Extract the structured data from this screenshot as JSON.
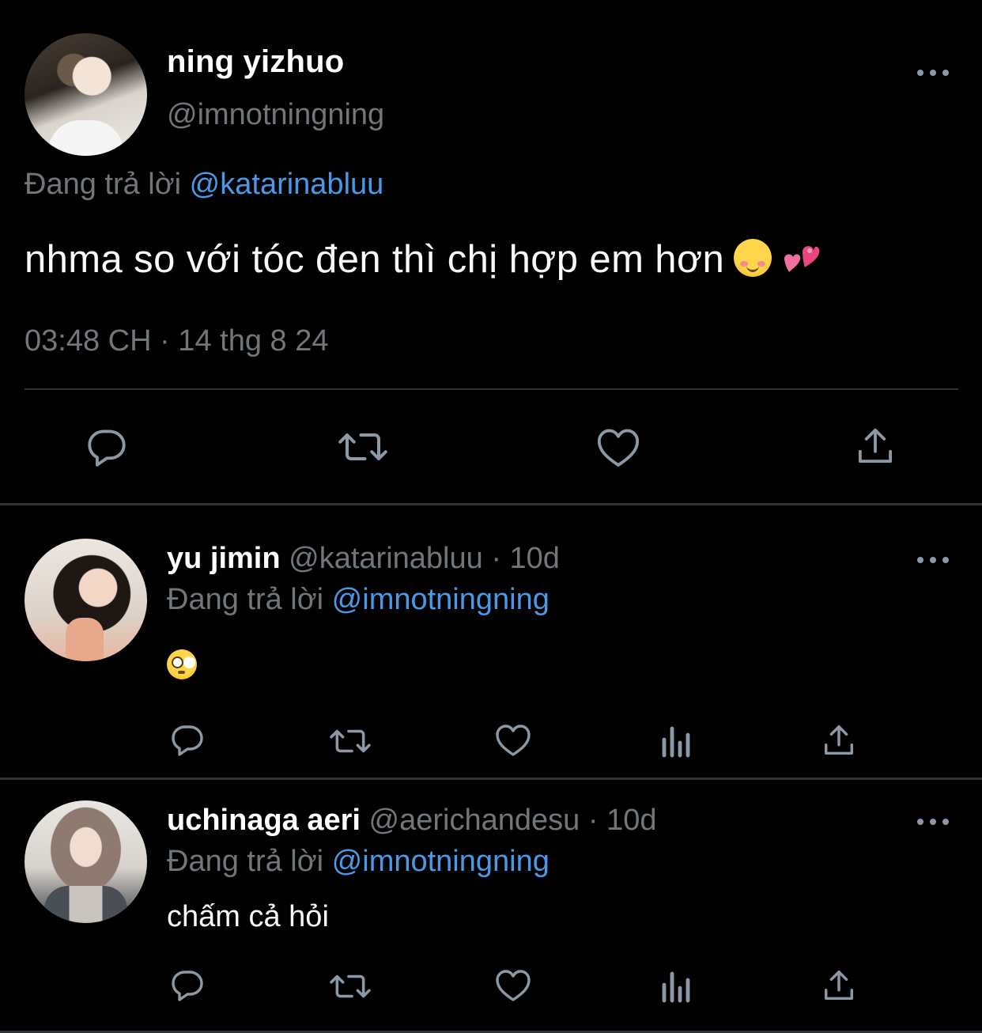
{
  "main_tweet": {
    "display_name": "ning yizhuo",
    "handle": "@imnotningning",
    "reply_prefix": "Đang trả lời",
    "reply_to": "@katarinabluu",
    "text": "nhma so với tóc đen thì chị hợp em hơn",
    "emojis": [
      "smiling-face-icon",
      "revolving-hearts-icon"
    ],
    "timestamp": "03:48 CH · 14 thg 8 24",
    "actions": [
      "reply-icon",
      "retweet-icon",
      "like-icon",
      "share-icon"
    ]
  },
  "replies": [
    {
      "display_name": "yu jimin",
      "handle": "@katarinabluu",
      "age": "10d",
      "reply_prefix": "Đang trả lời",
      "reply_to": "@imnotningning",
      "text": "",
      "emoji": "flushed-face-icon"
    },
    {
      "display_name": "uchinaga aeri",
      "handle": "@aerichandesu",
      "age": "10d",
      "reply_prefix": "Đang trả lời",
      "reply_to": "@imnotningning",
      "text": "chấm cả hỏi"
    }
  ],
  "separator": "·",
  "colors": {
    "background": "#000000",
    "primary_text": "#e7e9ea",
    "secondary_text": "#71767b",
    "link": "#4a99e9",
    "divider": "#2f3336",
    "icon": "#8b98a5"
  }
}
